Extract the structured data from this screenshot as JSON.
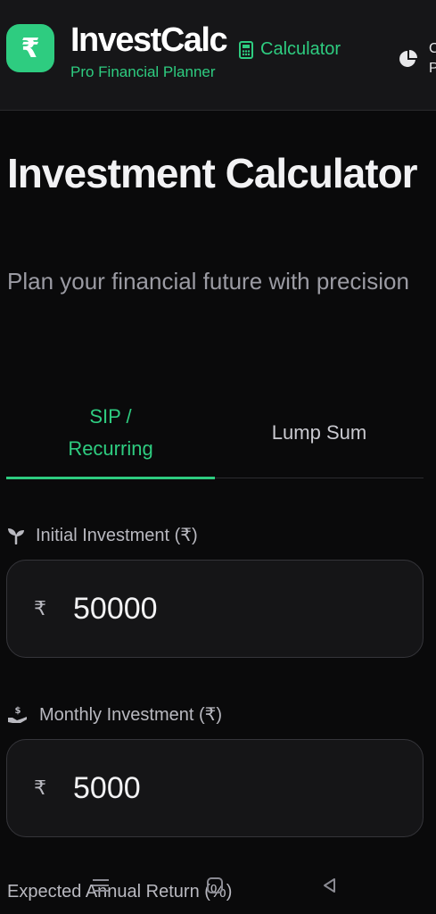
{
  "header": {
    "logo_symbol": "₹",
    "brand_title": "InvestCalc",
    "brand_subtitle": "Pro Financial Planner",
    "nav": {
      "calculator_label": "Calculator",
      "calculator_icon": "calculator-icon",
      "portfolio_icon": "pie-chart-icon",
      "portfolio_label_line1": "C",
      "portfolio_label_line2": "P"
    }
  },
  "page": {
    "title": "Investment Calculator",
    "subtitle": "Plan your financial future with precision"
  },
  "tabs": [
    {
      "label_line1": "SIP /",
      "label_line2": "Recurring",
      "active": true
    },
    {
      "label": "Lump Sum",
      "active": false
    }
  ],
  "fields": {
    "initial_investment": {
      "label": "Initial Investment (₹)",
      "icon": "seedling-icon",
      "prefix": "₹",
      "value": "50000"
    },
    "monthly_investment": {
      "label": "Monthly Investment (₹)",
      "icon": "hand-coin-icon",
      "prefix": "₹",
      "value": "5000"
    },
    "expected_return": {
      "label": "Expected Annual Return (%)"
    }
  },
  "system_nav": {
    "menu_icon": "menu-icon",
    "home_icon": "home-icon",
    "back_icon": "back-icon"
  },
  "colors": {
    "accent": "#2ecc80",
    "background": "#0a0a0b",
    "header_bg": "#161618",
    "field_bg": "#151517",
    "muted_text": "#9b9ba3"
  }
}
